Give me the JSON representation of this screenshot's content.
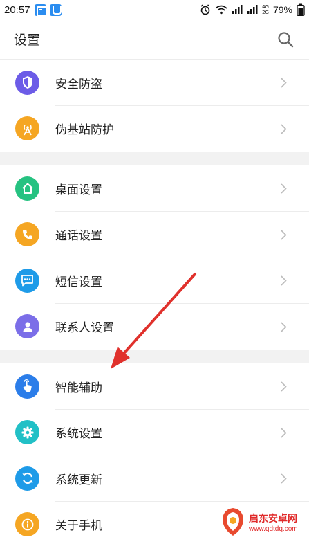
{
  "status_bar": {
    "time": "20:57",
    "battery": "79%",
    "network_top": "4G",
    "network_bottom": "2G"
  },
  "header": {
    "title": "设置"
  },
  "sections": [
    {
      "items": [
        {
          "label": "安全防盗",
          "icon": "shield-icon",
          "color": "#6c5ce7"
        },
        {
          "label": "伪基站防护",
          "icon": "antenna-icon",
          "color": "#f5a623"
        }
      ]
    },
    {
      "items": [
        {
          "label": "桌面设置",
          "icon": "home-icon",
          "color": "#26c281"
        },
        {
          "label": "通话设置",
          "icon": "phone-icon",
          "color": "#f5a623"
        },
        {
          "label": "短信设置",
          "icon": "message-icon",
          "color": "#1e9be8"
        },
        {
          "label": "联系人设置",
          "icon": "contact-icon",
          "color": "#7b6ee8"
        }
      ]
    },
    {
      "items": [
        {
          "label": "智能辅助",
          "icon": "hand-pointer-icon",
          "color": "#2b7de9"
        },
        {
          "label": "系统设置",
          "icon": "gear-icon",
          "color": "#22c0c6"
        },
        {
          "label": "系统更新",
          "icon": "refresh-icon",
          "color": "#1e9be8"
        },
        {
          "label": "关于手机",
          "icon": "info-icon",
          "color": "#f5a623"
        }
      ]
    }
  ],
  "watermark": {
    "name": "启东安卓网",
    "url": "www.qdtdq.com"
  }
}
